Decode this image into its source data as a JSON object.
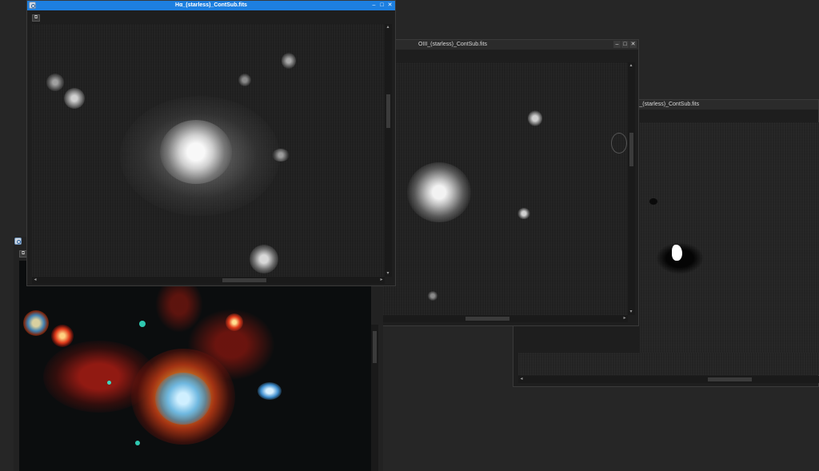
{
  "windows": {
    "ha": {
      "title": "Hα_(starless)_ContSub.fits"
    },
    "oiii": {
      "title": "OIII_(starless)_ContSub.fits"
    },
    "sii": {
      "title": "SII_(starless)_ContSub.fits"
    }
  },
  "icons": {
    "minimize": "minimize-icon",
    "maximize": "maximize-icon",
    "close": "close-icon",
    "view_options": "view-options-icon"
  },
  "colors": {
    "active_titlebar": "#1d7fe0",
    "inactive_titlebar": "#2b2b2b",
    "workspace": "#262626"
  }
}
